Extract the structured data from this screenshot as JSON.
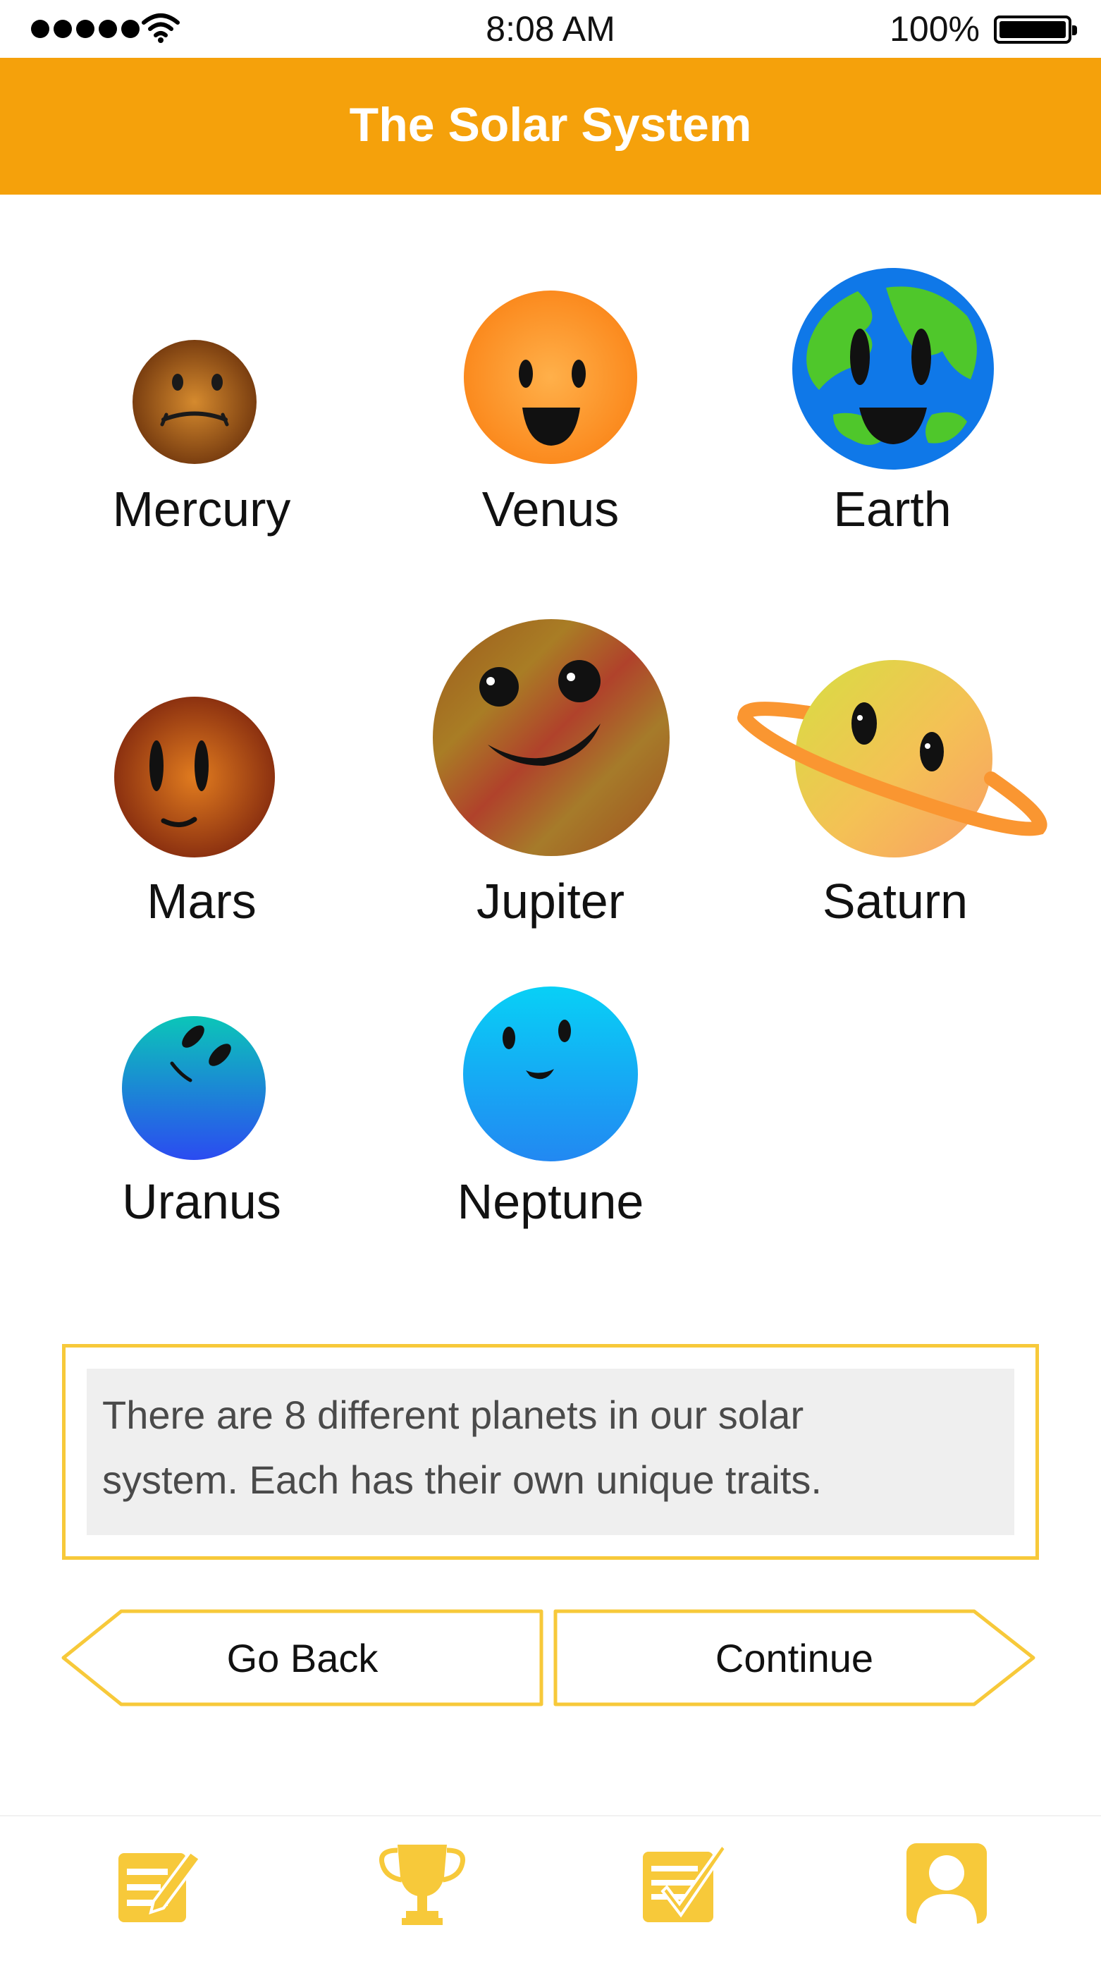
{
  "status_bar": {
    "time": "8:08 AM",
    "battery_percent": "100%",
    "signal_bars": 5,
    "icons": [
      "signal-icon",
      "wifi-icon",
      "battery-icon"
    ]
  },
  "header": {
    "title": "The Solar System",
    "color": "#F5A10B"
  },
  "planets": [
    {
      "name": "Mercury",
      "icon": "mercury-face-icon"
    },
    {
      "name": "Venus",
      "icon": "venus-face-icon"
    },
    {
      "name": "Earth",
      "icon": "earth-face-icon"
    },
    {
      "name": "Mars",
      "icon": "mars-face-icon"
    },
    {
      "name": "Jupiter",
      "icon": "jupiter-face-icon"
    },
    {
      "name": "Saturn",
      "icon": "saturn-face-icon"
    },
    {
      "name": "Uranus",
      "icon": "uranus-face-icon"
    },
    {
      "name": "Neptune",
      "icon": "neptune-face-icon"
    }
  ],
  "info": {
    "line1": "There are 8 different planets in our solar",
    "line2": "system. Each has their own unique traits."
  },
  "buttons": {
    "back_label": "Go Back",
    "continue_label": "Continue",
    "border_color": "#F7C93A"
  },
  "tab_bar": {
    "accent": "#F7C93A",
    "tabs": [
      {
        "icon": "notepad-pencil-icon"
      },
      {
        "icon": "trophy-icon"
      },
      {
        "icon": "checklist-icon"
      },
      {
        "icon": "profile-icon"
      }
    ]
  }
}
